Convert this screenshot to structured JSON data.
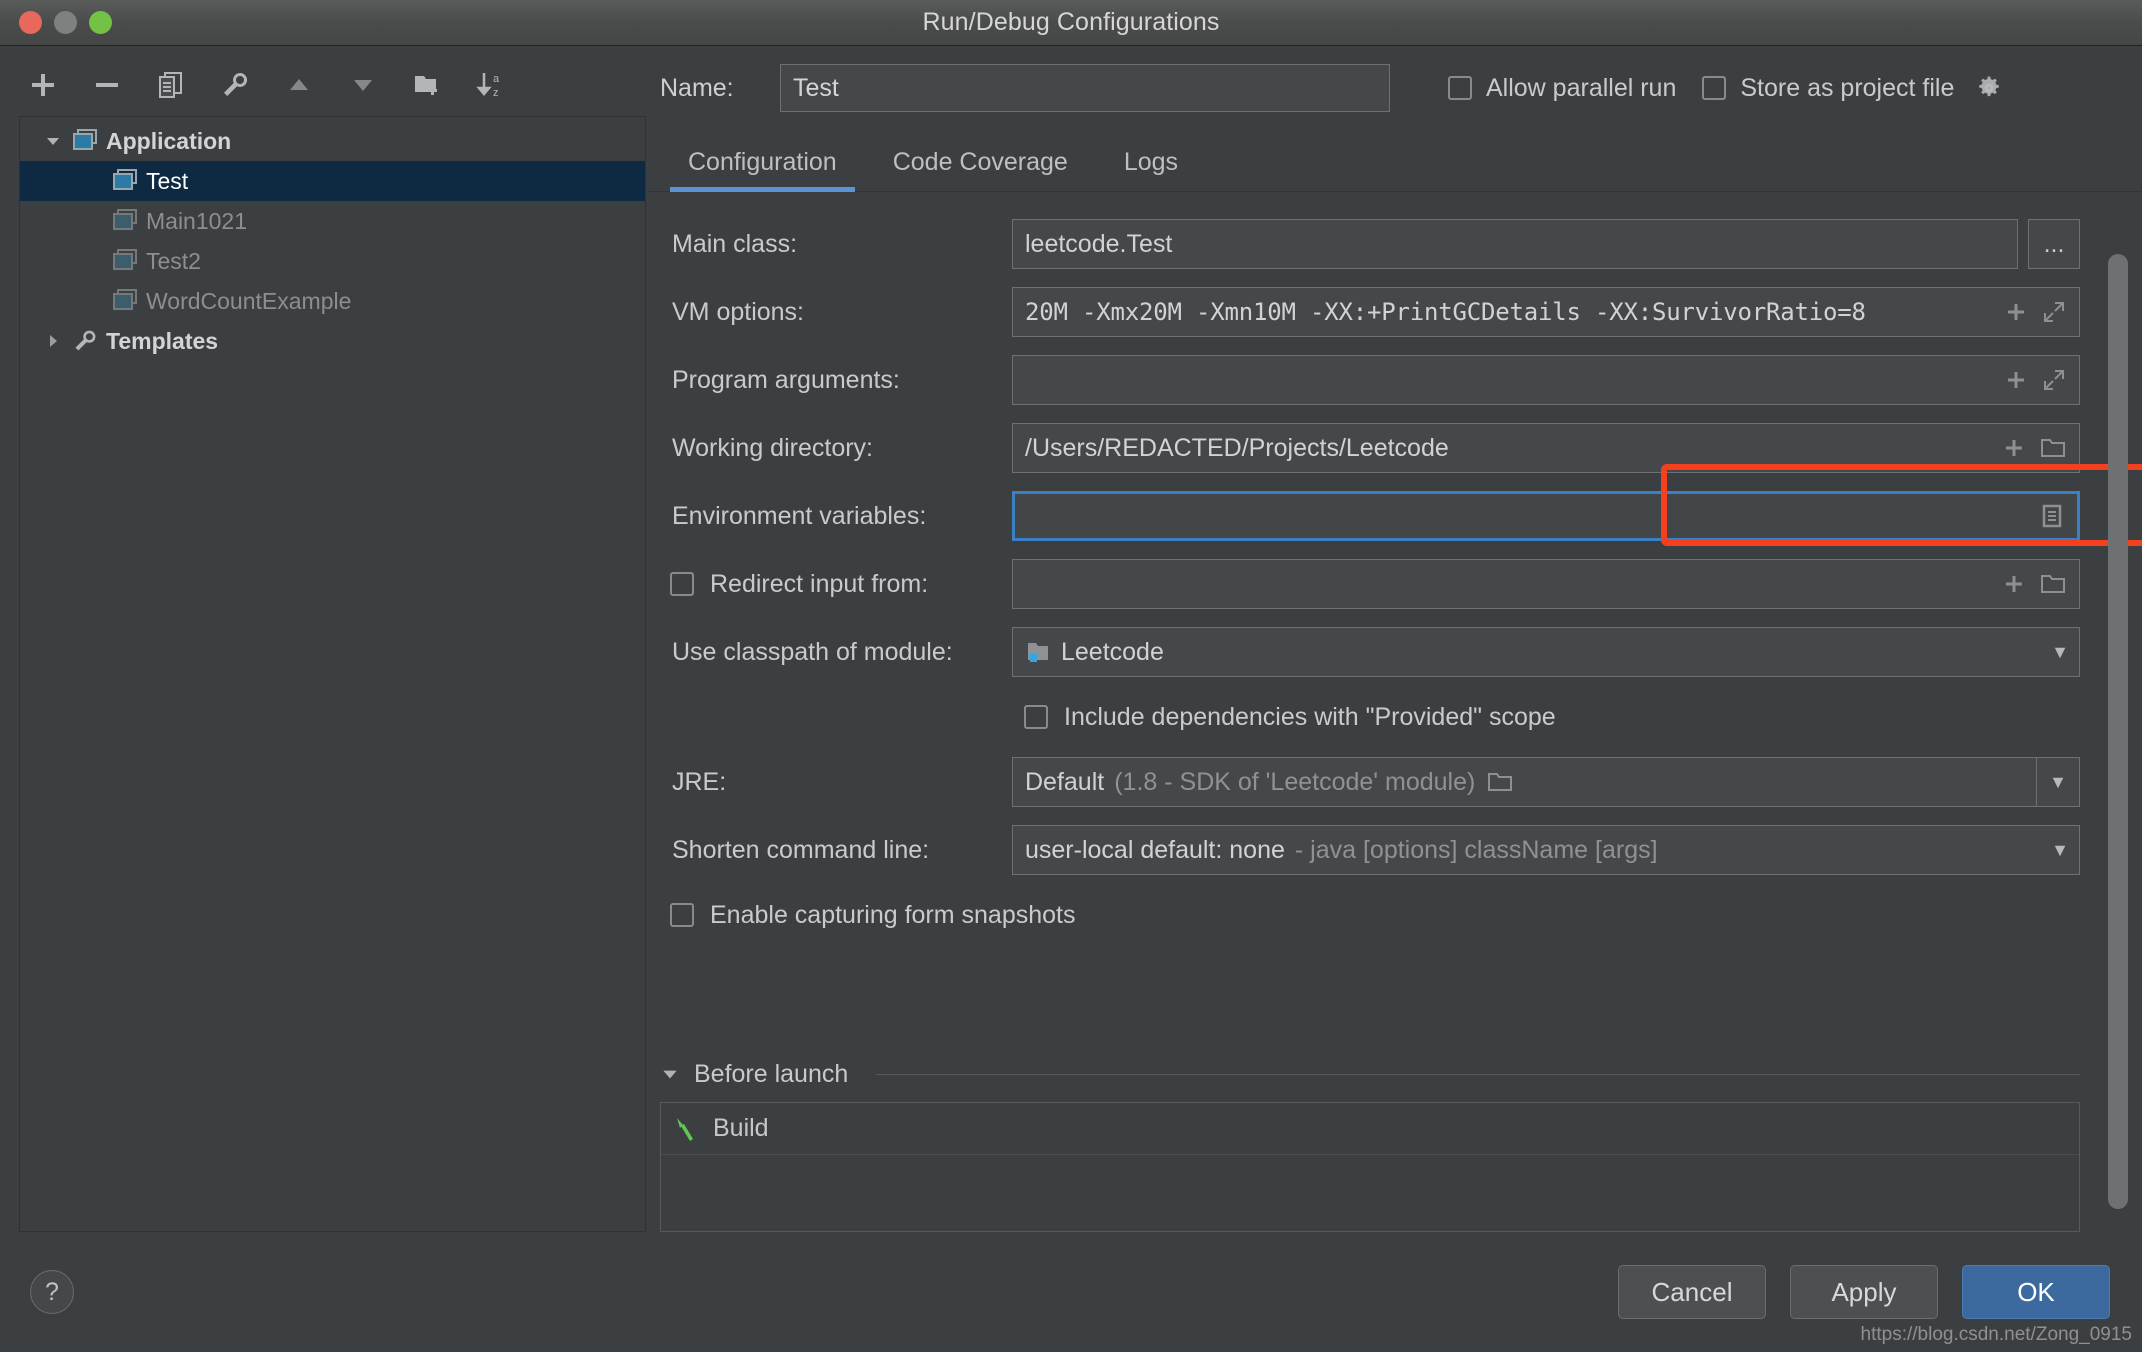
{
  "window": {
    "title": "Run/Debug Configurations",
    "traffic_lights": [
      "close",
      "minimize",
      "zoom"
    ]
  },
  "toolbar": {
    "buttons": [
      {
        "name": "add-button",
        "icon": "plus-icon"
      },
      {
        "name": "remove-button",
        "icon": "minus-icon"
      },
      {
        "name": "copy-configuration-button",
        "icon": "copy-icon"
      },
      {
        "name": "edit-templates-button",
        "icon": "wrench-icon"
      },
      {
        "name": "move-up-button",
        "icon": "triangle-up-icon"
      },
      {
        "name": "move-down-button",
        "icon": "triangle-down-icon"
      },
      {
        "name": "create-folder-button",
        "icon": "folder-plus-icon"
      },
      {
        "name": "sort-alphabetically-button",
        "icon": "sort-az-icon"
      }
    ]
  },
  "tree": {
    "nodes": [
      {
        "label": "Application",
        "level": 0,
        "expanded": true,
        "selected": false,
        "icon": "application-icon",
        "dim": false
      },
      {
        "label": "Test",
        "level": 1,
        "selected": true,
        "icon": "application-icon",
        "dim": false
      },
      {
        "label": "Main1021",
        "level": 1,
        "selected": false,
        "icon": "application-icon",
        "dim": true
      },
      {
        "label": "Test2",
        "level": 1,
        "selected": false,
        "icon": "application-icon",
        "dim": true
      },
      {
        "label": "WordCountExample",
        "level": 1,
        "selected": false,
        "icon": "application-icon",
        "dim": true
      },
      {
        "label": "Templates",
        "level": 0,
        "expanded": false,
        "selected": false,
        "icon": "wrench-icon",
        "dim": false
      }
    ]
  },
  "help": {
    "label": "?"
  },
  "name_row": {
    "label": "Name:",
    "value": "Test",
    "placeholder": "",
    "allow_parallel_run": {
      "label": "Allow parallel run",
      "checked": false
    },
    "store_as_project_file": {
      "label": "Store as project file",
      "checked": false
    },
    "gear_icon": "gear-icon"
  },
  "tabs": [
    {
      "label": "Configuration",
      "active": true
    },
    {
      "label": "Code Coverage",
      "active": false
    },
    {
      "label": "Logs",
      "active": false
    }
  ],
  "form": {
    "main_class": {
      "label": "Main class:",
      "value": "leetcode.Test",
      "browse_label": "..."
    },
    "vm_options": {
      "label": "VM options:",
      "value": "20M -Xmx20M -Xmn10M -XX:+PrintGCDetails -XX:SurvivorRatio=8",
      "highlighted": true
    },
    "program_arguments": {
      "label": "Program arguments:",
      "value": ""
    },
    "working_directory": {
      "label": "Working directory:",
      "value": "/Users/REDACTED/Projects/Leetcode"
    },
    "environment_variables": {
      "label": "Environment variables:",
      "value": "",
      "focused": true
    },
    "redirect_input_from": {
      "label": "Redirect input from:",
      "checked": false,
      "value": ""
    },
    "use_classpath_of_module": {
      "label": "Use classpath of module:",
      "value": "Leetcode"
    },
    "include_provided_scope": {
      "label": "Include dependencies with \"Provided\" scope",
      "checked": false
    },
    "jre": {
      "label": "JRE:",
      "value": "Default",
      "value_detail": "(1.8 - SDK of 'Leetcode' module)"
    },
    "shorten_command_line": {
      "label": "Shorten command line:",
      "value": "user-local default: none",
      "value_detail": "- java [options] className [args]"
    },
    "enable_form_snapshots": {
      "label": "Enable capturing form snapshots",
      "checked": false
    }
  },
  "before_launch": {
    "header": "Before launch",
    "items": [
      {
        "label": "Build",
        "icon": "hammer-icon"
      }
    ]
  },
  "footer": {
    "cancel": "Cancel",
    "apply": "Apply",
    "ok": "OK"
  },
  "watermark": "https://blog.csdn.net/Zong_0915",
  "colors": {
    "window_bg": "#3c3f41",
    "field_bg": "#45484a",
    "accent_blue": "#5a94d4",
    "selection_blue": "#0d2a42",
    "focus_border": "#3b7fc4",
    "annotation_red": "#f4401f",
    "ok_button": "#3c6a9e",
    "build_green": "#62c554"
  }
}
